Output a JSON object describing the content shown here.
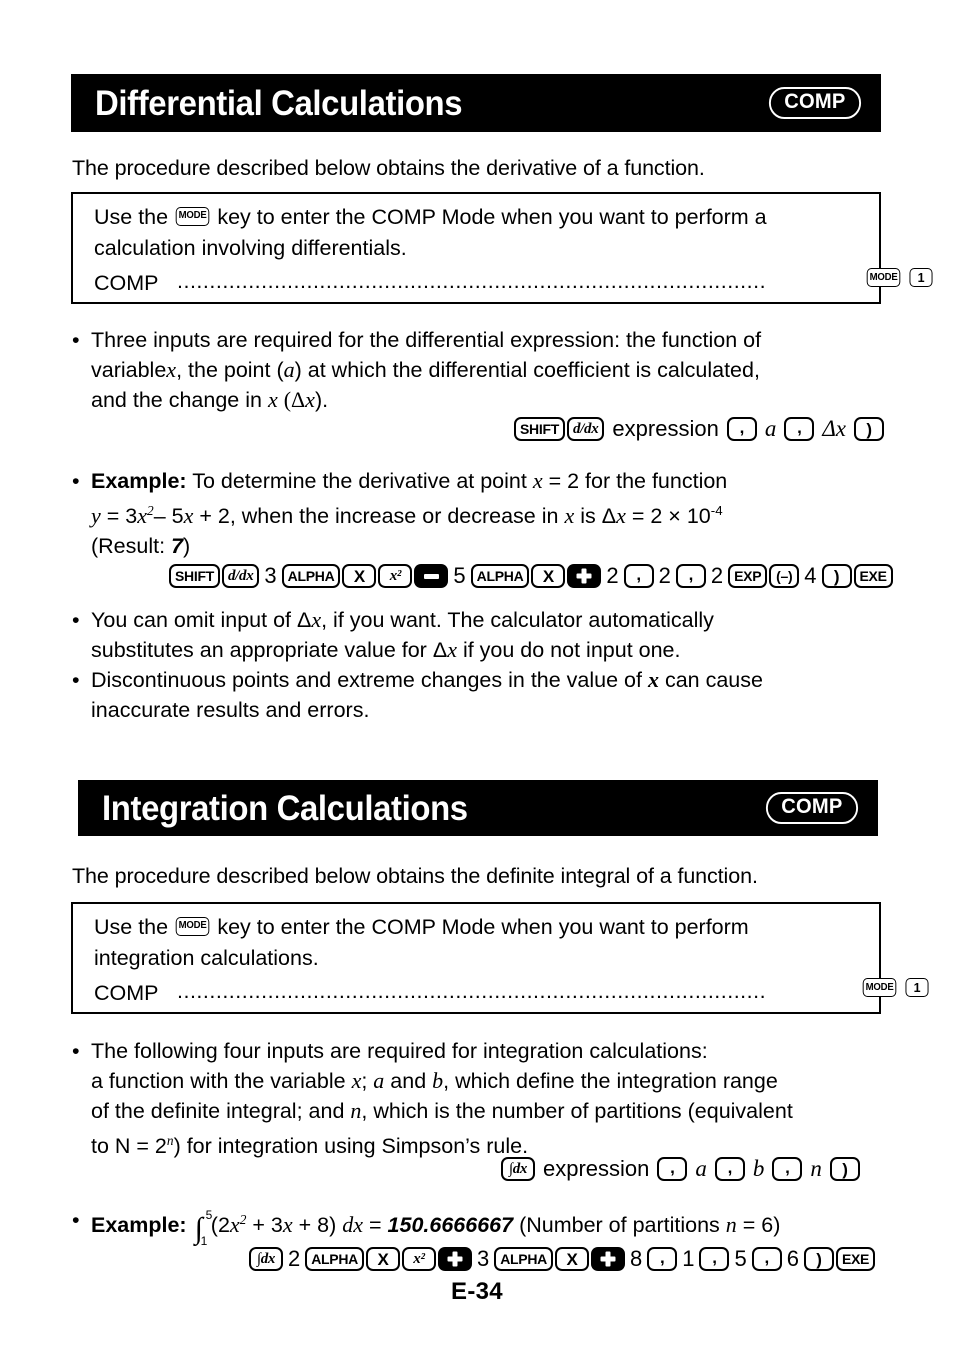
{
  "page": {
    "footer": "E-34"
  },
  "sections": [
    {
      "title": "Differential Calculations",
      "badge": "COMP",
      "intro": "The procedure described below obtains the derivative of a function.",
      "note": {
        "line1_a": "Use the",
        "key_mode": "MODE",
        "line1_b": "key to enter the COMP Mode when you want to perform a",
        "line2": "calculation involving differentials.",
        "label": "COMP",
        "dots": "...........................................................................................",
        "key_mode2": "MODE",
        "key_one": "1"
      }
    },
    {
      "title": "Integration Calculations",
      "badge": "COMP",
      "intro": "The procedure described below obtains the definite integral of a function.",
      "note": {
        "line1_a": "Use the",
        "key_mode": "MODE",
        "line1_b": "key to enter the COMP Mode when you want to perform",
        "line2": "integration calculations.",
        "label": "COMP",
        "dots": "...........................................................................................",
        "key_mode2": "MODE",
        "key_one": "1"
      }
    }
  ],
  "diff_bullets": {
    "inputs": {
      "l1": "Three inputs are required for the differential expression: the function of",
      "l2_a": "variable",
      "l2_x": "x",
      "l2_b": ", the point (",
      "l2_a2": "a",
      "l2_c": ") at which the differential coefficient is calculated,",
      "l3_a": "and the change in",
      "l3_x": "x",
      "l3_b": "(Δ",
      "l3_x2": "x",
      "l3_c": ")."
    },
    "syntax": {
      "k1": "SHIFT",
      "k2": "d/dx",
      "word": "expression",
      "comma1": ",",
      "a": "a",
      "comma2": ",",
      "dx": "Δx",
      "close": ")"
    },
    "example": {
      "label": "Example:",
      "l1": "To determine the derivative at point",
      "l1_x": "x",
      "l1_b": "= 2 for the function",
      "l2_y": "y",
      "l2_a": "= 3",
      "l2_x": "x",
      "l2_sup": "2",
      "l2_b": "– 5",
      "l2_x2": "x",
      "l2_c": "+ 2, when the increase or decrease in",
      "l2_x3": "x",
      "l2_d": "is Δ",
      "l2_x4": "x",
      "l2_e": "= 2 × 10",
      "l2_sup2": "-4",
      "l3_a": "(Result:",
      "l3_res": "7",
      "l3_b": ")"
    },
    "keys": [
      {
        "type": "key",
        "label": "SHIFT",
        "style": "wide"
      },
      {
        "type": "key",
        "label": "d/dx",
        "style": "math"
      },
      {
        "type": "num",
        "label": "3"
      },
      {
        "type": "key",
        "label": "ALPHA",
        "style": "wide"
      },
      {
        "type": "key",
        "label": "X",
        "style": "letter"
      },
      {
        "type": "key",
        "label": "x²",
        "style": "math"
      },
      {
        "type": "op",
        "label": "minus"
      },
      {
        "type": "num",
        "label": "5"
      },
      {
        "type": "key",
        "label": "ALPHA",
        "style": "wide"
      },
      {
        "type": "key",
        "label": "X",
        "style": "letter"
      },
      {
        "type": "op",
        "label": "plus"
      },
      {
        "type": "num",
        "label": "2"
      },
      {
        "type": "key",
        "label": ",",
        "style": "comma"
      },
      {
        "type": "num",
        "label": "2"
      },
      {
        "type": "key",
        "label": ",",
        "style": "comma"
      },
      {
        "type": "num",
        "label": "2"
      },
      {
        "type": "key",
        "label": "EXP",
        "style": "narrow"
      },
      {
        "type": "key",
        "label": "(–)",
        "style": "narrow"
      },
      {
        "type": "num",
        "label": "4"
      },
      {
        "type": "key",
        "label": ")",
        "style": "paren"
      },
      {
        "type": "key",
        "label": "EXE",
        "style": "narrow"
      }
    ],
    "omit": {
      "l1_a": "You can omit input of Δ",
      "l1_x": "x",
      "l1_b": ", if you want. The calculator automatically",
      "l2_a": "substitutes an appropriate value for Δ",
      "l2_x": "x",
      "l2_b": "if you do not input one."
    },
    "discontinuous": {
      "l1_a": "Discontinuous points and extreme changes in the value of",
      "l1_x": "x",
      "l1_b": "can cause",
      "l2": "inaccurate results and errors."
    }
  },
  "int_bullets": {
    "inputs": {
      "l1": "The following four inputs are required for integration calculations:",
      "l2_a": "a function with the variable",
      "l2_x": "x",
      "l2_b": ";",
      "l2_av": "a",
      "l2_c": "and",
      "l2_bv": "b",
      "l2_d": ", which define the integration range",
      "l3_a": "of the definite integral; and",
      "l3_n": "n",
      "l3_b": ", which is the number of partitions (equivalent",
      "l4_a": "to N = 2",
      "l4_sup": "n",
      "l4_b": ") for integration using Simpson’s rule."
    },
    "syntax": {
      "k1": "∫dx",
      "word": "expression",
      "comma1": ",",
      "a": "a",
      "comma2": ",",
      "b": "b",
      "comma3": ",",
      "n": "n",
      "close": ")"
    },
    "example": {
      "label": "Example:",
      "lower": "1",
      "upper": "5",
      "expr_a": "(2",
      "expr_x": "x",
      "expr_sup": "2",
      "expr_b": "+ 3",
      "expr_x2": "x",
      "expr_c": "+ 8)",
      "dx": "dx",
      "eq": "=",
      "result": "150.6666667",
      "note_a": "(Number of partitions",
      "note_n": "n",
      "note_b": "= 6)"
    },
    "keys": [
      {
        "type": "key",
        "label": "∫dx",
        "style": "math"
      },
      {
        "type": "num",
        "label": "2"
      },
      {
        "type": "key",
        "label": "ALPHA",
        "style": "wide"
      },
      {
        "type": "key",
        "label": "X",
        "style": "letter"
      },
      {
        "type": "key",
        "label": "x²",
        "style": "math"
      },
      {
        "type": "op",
        "label": "plus"
      },
      {
        "type": "num",
        "label": "3"
      },
      {
        "type": "key",
        "label": "ALPHA",
        "style": "wide"
      },
      {
        "type": "key",
        "label": "X",
        "style": "letter"
      },
      {
        "type": "op",
        "label": "plus"
      },
      {
        "type": "num",
        "label": "8"
      },
      {
        "type": "key",
        "label": ",",
        "style": "comma"
      },
      {
        "type": "num",
        "label": "1"
      },
      {
        "type": "key",
        "label": ",",
        "style": "comma"
      },
      {
        "type": "num",
        "label": "5"
      },
      {
        "type": "key",
        "label": ",",
        "style": "comma"
      },
      {
        "type": "num",
        "label": "6"
      },
      {
        "type": "key",
        "label": ")",
        "style": "paren"
      },
      {
        "type": "key",
        "label": "EXE",
        "style": "narrow"
      }
    ]
  }
}
